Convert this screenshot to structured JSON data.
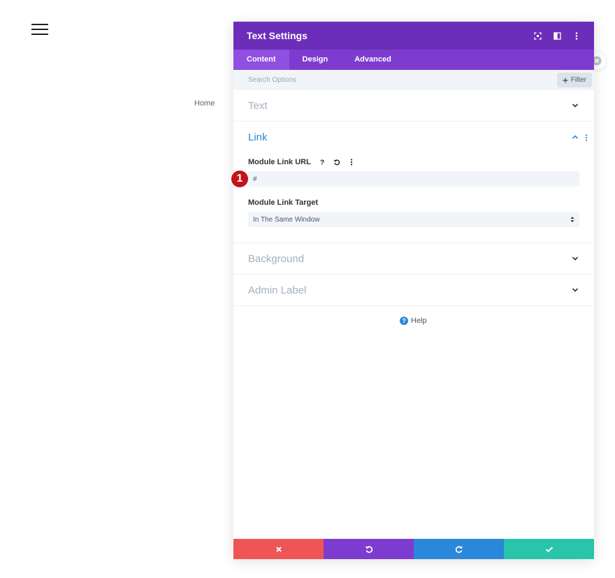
{
  "page": {
    "nav_home": "Home"
  },
  "modal": {
    "title": "Text Settings",
    "header_icons": [
      "focus-mode-icon",
      "split-view-icon",
      "more-options-icon"
    ],
    "tabs": [
      {
        "label": "Content",
        "active": true
      },
      {
        "label": "Design",
        "active": false
      },
      {
        "label": "Advanced",
        "active": false
      }
    ],
    "search": {
      "placeholder": "Search Options",
      "filter_label": "Filter"
    },
    "sections": {
      "text": {
        "title": "Text",
        "expanded": false
      },
      "link": {
        "title": "Link",
        "expanded": true,
        "url_label": "Module Link URL",
        "url_value": "#",
        "step_badge": "1",
        "target_label": "Module Link Target",
        "target_value": "In The Same Window"
      },
      "background": {
        "title": "Background",
        "expanded": false
      },
      "admin_label": {
        "title": "Admin Label",
        "expanded": false
      }
    },
    "help_label": "Help",
    "footer_buttons": [
      "cancel-icon",
      "undo-icon",
      "redo-icon",
      "save-check-icon"
    ]
  },
  "colors": {
    "header": "#6c2eb9",
    "tabs": "#7d3bcf",
    "active_tab": "#8f4fe0",
    "accent_blue": "#2b87da",
    "cancel": "#ef5555",
    "undo": "#7e3bd0",
    "redo": "#2b87da",
    "save": "#29c4a9",
    "step_badge": "#c4121a"
  }
}
